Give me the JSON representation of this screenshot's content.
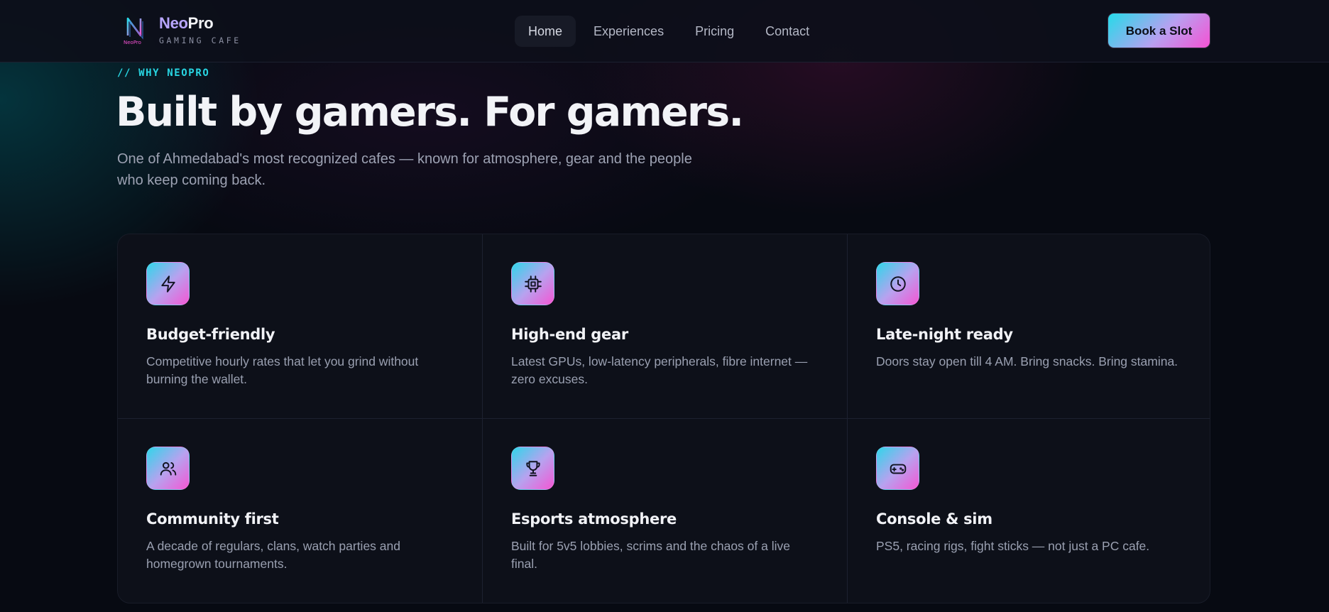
{
  "header": {
    "brand_part1": "Neo",
    "brand_part2": "Pro",
    "tagline": "GAMING CAFE",
    "logo_mark_text": "NeoPro",
    "nav": [
      {
        "label": "Home",
        "active": true
      },
      {
        "label": "Experiences",
        "active": false
      },
      {
        "label": "Pricing",
        "active": false
      },
      {
        "label": "Contact",
        "active": false
      }
    ],
    "cta_label": "Book a Slot"
  },
  "hero": {
    "eyebrow": "// WHY NEOPRO",
    "title": "Built by gamers. For gamers.",
    "subtitle": "One of Ahmedabad's most recognized cafes — known for atmosphere, gear and the people who keep coming back."
  },
  "features": [
    {
      "icon": "lightning-icon",
      "title": "Budget-friendly",
      "desc": "Competitive hourly rates that let you grind without burning the wallet."
    },
    {
      "icon": "chip-icon",
      "title": "High-end gear",
      "desc": "Latest GPUs, low-latency peripherals, fibre internet — zero excuses."
    },
    {
      "icon": "clock-icon",
      "title": "Late-night ready",
      "desc": "Doors stay open till 4 AM. Bring snacks. Bring stamina."
    },
    {
      "icon": "users-icon",
      "title": "Community first",
      "desc": "A decade of regulars, clans, watch parties and homegrown tournaments."
    },
    {
      "icon": "trophy-icon",
      "title": "Esports atmosphere",
      "desc": "Built for 5v5 lobbies, scrims and the chaos of a live final."
    },
    {
      "icon": "gamepad-icon",
      "title": "Console & sim",
      "desc": "PS5, racing rigs, fight sticks — not just a PC cafe."
    }
  ],
  "colors": {
    "accent_cyan": "#25dbe9",
    "accent_lilac": "#b8a0f0",
    "accent_pink": "#f552d4",
    "background": "#070a12"
  }
}
